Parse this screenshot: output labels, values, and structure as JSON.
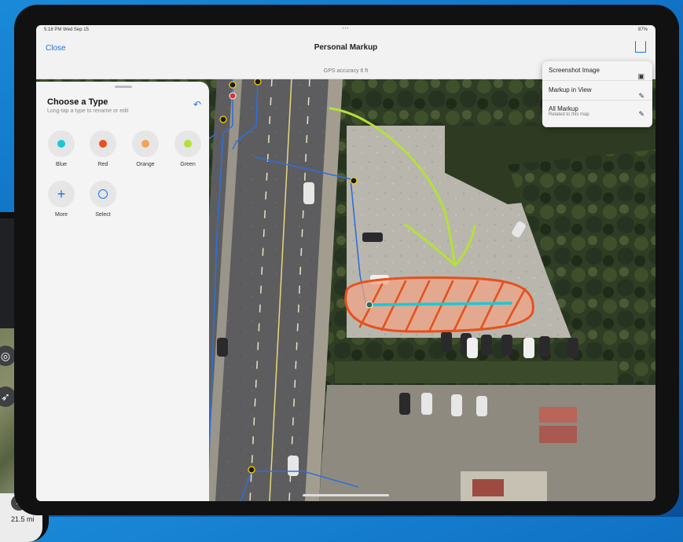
{
  "phone": {
    "distance": "21.5 mi"
  },
  "status": {
    "time": "5:18 PM   Wed Sep 15",
    "dots": "•••",
    "battery": "87%"
  },
  "nav": {
    "close_label": "Close",
    "title": "Personal Markup"
  },
  "gps": {
    "label": "GPS accuracy 6 ft"
  },
  "panel": {
    "title": "Choose a Type",
    "subtitle": "Long-tap a type to rename or edit",
    "types": [
      {
        "label": "Blue",
        "color": "#19c9d6"
      },
      {
        "label": "Red",
        "color": "#e6511c"
      },
      {
        "label": "Orange",
        "color": "#f2a45a"
      },
      {
        "label": "Green",
        "color": "#b6e039"
      }
    ],
    "more_label": "More",
    "select_label": "Select"
  },
  "menu": {
    "items": [
      {
        "label": "Screenshot Image",
        "icon": "image-icon"
      },
      {
        "label": "Markup in View",
        "icon": "pencil-icon"
      },
      {
        "label": "All Markup",
        "sublabel": "Related to this map",
        "icon": "pencil-icon"
      }
    ]
  },
  "colors": {
    "accent": "#1a73e8",
    "markup_green": "#b6e039",
    "markup_red": "#e6511c",
    "markup_blue": "#19c9d6"
  }
}
